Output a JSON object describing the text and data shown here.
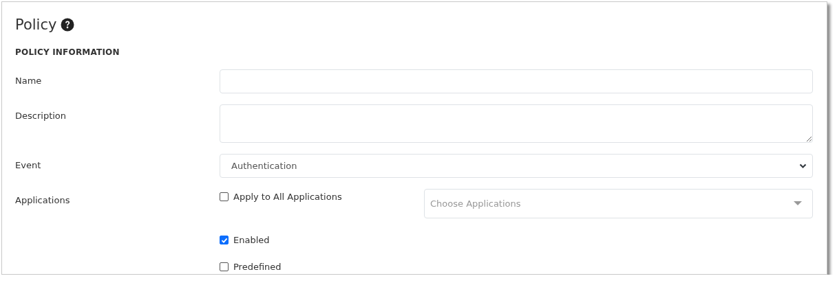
{
  "title": "Policy",
  "section": "POLICY INFORMATION",
  "fields": [
    {
      "kind": "text",
      "label": "Name"
    },
    {
      "kind": "textarea",
      "label": "Description"
    },
    {
      "kind": "select",
      "label": "Event",
      "value": "Authentication"
    },
    {
      "kind": "applications",
      "label": "Applications",
      "checkbox": {
        "label": "Apply to All Applications",
        "checked": false
      },
      "placeholder": "Choose Applications"
    }
  ],
  "options": [
    {
      "label": "Enabled",
      "checked": true
    },
    {
      "label": "Predefined",
      "checked": false
    }
  ]
}
